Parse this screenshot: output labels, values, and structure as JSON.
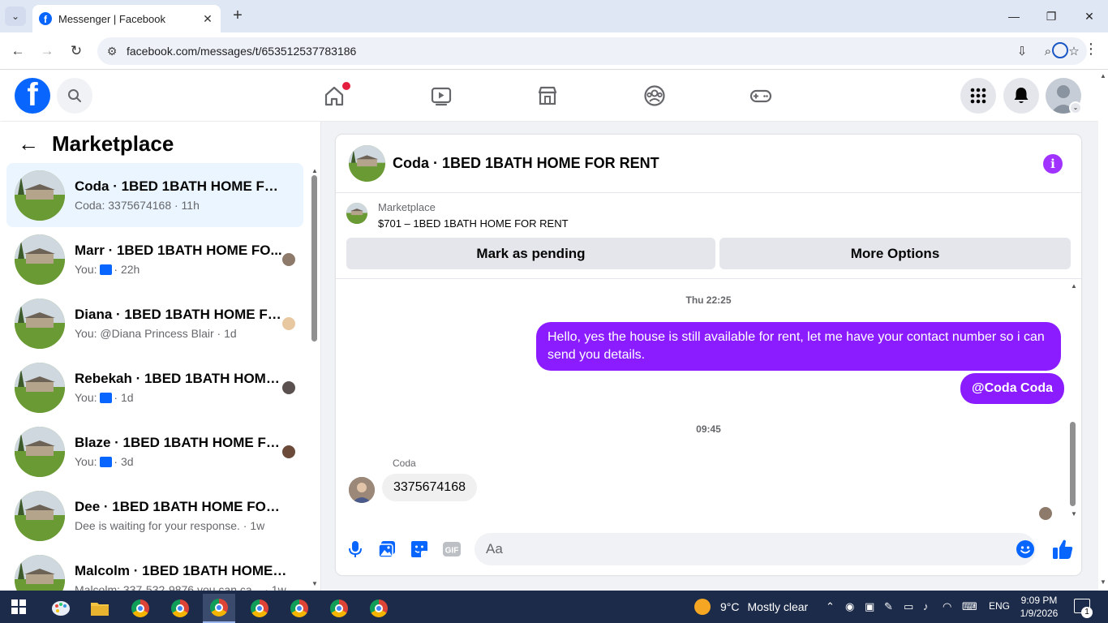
{
  "browser": {
    "tab_title": "Messenger | Facebook",
    "url": "facebook.com/messages/t/653512537783186"
  },
  "sidebar": {
    "title": "Marketplace",
    "conversations": [
      {
        "name": "Coda · 1BED 1BATH HOME FOR R...",
        "preview": "Coda: 3375674168 · 11h",
        "active": true
      },
      {
        "name": "Marr · 1BED 1BATH HOME FO...",
        "prefix": "You:",
        "preview": "· 22h",
        "like": true
      },
      {
        "name": "Diana · 1BED 1BATH HOME FO...",
        "preview": "You: @Diana Princess Blair · 1d"
      },
      {
        "name": "Rebekah · 1BED 1BATH HOME ...",
        "prefix": "You:",
        "preview": "· 1d",
        "like": true
      },
      {
        "name": "Blaze · 1BED 1BATH HOME FO...",
        "prefix": "You:",
        "preview": "· 3d",
        "like": true
      },
      {
        "name": "Dee · 1BED 1BATH HOME FOR RE...",
        "preview": "Dee is waiting for your response. · 1w"
      },
      {
        "name": "Malcolm · 1BED 1BATH HOME F...",
        "preview": "Malcolm: 337-532-9876 you can ca... · 1w"
      }
    ]
  },
  "chat": {
    "title": "Coda · 1BED 1BATH HOME FOR RENT",
    "listing_label": "Marketplace",
    "listing_price": "$701 – 1BED 1BATH HOME FOR RENT",
    "mark_pending_label": "Mark as pending",
    "more_options_label": "More Options",
    "messages": {
      "time_1": "Thu 22:25",
      "out_1": "Hello, yes the house is still available for rent, let me have your contact number so i can send you details.",
      "out_2": "@Coda Coda",
      "time_2": "09:45",
      "in_sender": "Coda",
      "in_1": "3375674168"
    },
    "composer_placeholder": "Aa"
  },
  "taskbar": {
    "weather_temp": "9°C",
    "weather_text": "Mostly clear",
    "language": "ENG",
    "time": "9:09 PM",
    "date": "1/9/2026",
    "notification_count": "1"
  },
  "colors": {
    "fb_blue": "#0866ff",
    "bubble_purple": "#8a1cff",
    "info_purple": "#a033ff",
    "active_row": "#ebf5ff"
  }
}
